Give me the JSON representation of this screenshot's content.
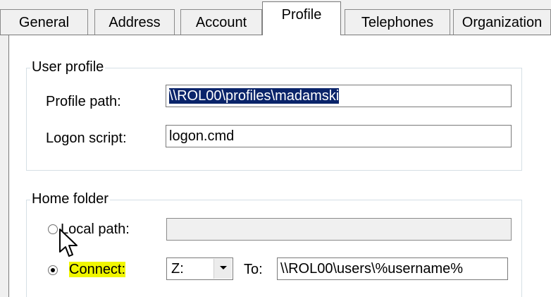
{
  "tabs": [
    {
      "label": "General",
      "active": false
    },
    {
      "label": "Address",
      "active": false
    },
    {
      "label": "Account",
      "active": false
    },
    {
      "label": "Profile",
      "active": true
    },
    {
      "label": "Telephones",
      "active": false
    },
    {
      "label": "Organization",
      "active": false
    }
  ],
  "user_profile": {
    "title": "User profile",
    "profile_path_label": "Profile path:",
    "profile_path_value": "\\\\ROL00\\profiles\\madamski",
    "logon_script_label": "Logon script:",
    "logon_script_value": "logon.cmd"
  },
  "home_folder": {
    "title": "Home folder",
    "local_path_label": "Local path:",
    "local_path_value": "",
    "local_path_selected": false,
    "connect_label": "Connect:",
    "connect_selected": true,
    "drive_value": "Z:",
    "to_label": "To:",
    "to_value": "\\\\ROL00\\users\\%username%"
  },
  "icons": {
    "dropdown": "chevron-down-icon",
    "cursor": "mouse-pointer-icon"
  },
  "colors": {
    "window_bg": "#f0f0f0",
    "page_bg": "#ffffff",
    "selection_bg": "#0a246a",
    "highlight": "#f0f600"
  }
}
